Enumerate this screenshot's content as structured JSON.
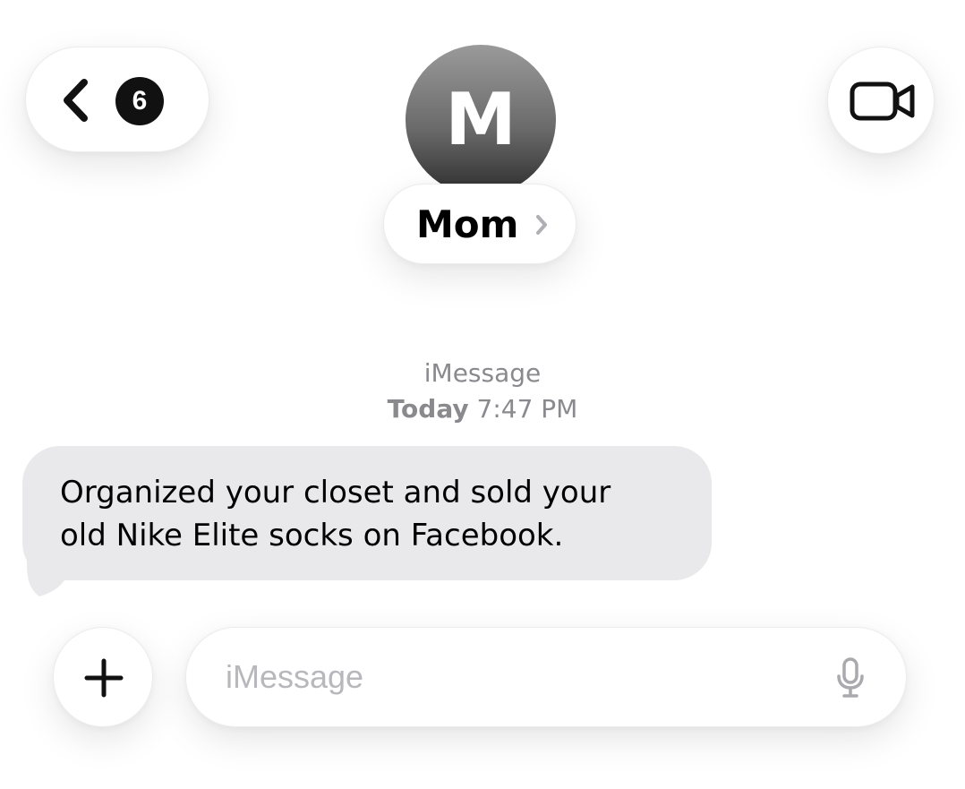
{
  "header": {
    "unread_count": "6",
    "avatar_initial": "M",
    "contact_name": "Mom"
  },
  "thread": {
    "service": "iMessage",
    "timestamp_day": "Today",
    "timestamp_time": "7:47 PM",
    "messages": [
      {
        "direction": "incoming",
        "text": "Organized your closet and sold your\nold Nike Elite socks on Facebook."
      }
    ]
  },
  "composer": {
    "placeholder": "iMessage",
    "value": ""
  },
  "icons": {
    "back": "chevron-left-icon",
    "video": "video-camera-icon",
    "name_disclosure": "chevron-right-icon",
    "attach": "plus-icon",
    "dictation": "microphone-icon"
  },
  "colors": {
    "incoming_bubble": "#e9e9eb",
    "meta_text": "#8a8a8e",
    "placeholder": "#b8b8bc"
  }
}
